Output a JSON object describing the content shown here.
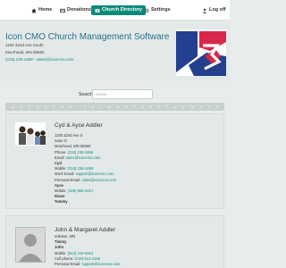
{
  "nav": {
    "home": "Home",
    "donations": "Donations",
    "church_directory": "Church Directory",
    "settings": "Settings",
    "logoff": "Log off"
  },
  "church": {
    "name": "Icon CMO Church Management Software",
    "address1": "1100 32nd Ave South",
    "address2": "Moorhead, MN 56560",
    "phone": "(218) 236-1699",
    "separator": " - ",
    "email": "sales@iconcmo.com"
  },
  "search": {
    "label": "Search:",
    "placeholder": "Name"
  },
  "alphabet": [
    "A",
    "B",
    "C",
    "D",
    "E",
    "F",
    "G",
    "H",
    "I",
    "J",
    "K",
    "L",
    "M",
    "N",
    "O",
    "P",
    "Q",
    "R",
    "S",
    "T",
    "U",
    "V",
    "W",
    "X",
    "Y",
    "Z"
  ],
  "families": [
    {
      "name": "Cyd & Ayce Addler",
      "lines": [
        {
          "text": "1100 32nd Ave S",
          "style": "plain"
        },
        {
          "text": "Suite G",
          "style": "plain"
        },
        {
          "text": "Moorhead, MN 56560",
          "style": "plain"
        },
        {
          "prefix": "Phone: ",
          "text": "(218) 236-1699",
          "style": "link"
        },
        {
          "prefix": "Email: ",
          "text": "sales@iconcmo.com",
          "style": "link"
        },
        {
          "text": "Cyd",
          "style": "bold"
        },
        {
          "prefix": "Mobile: ",
          "text": "(218) 236-1699",
          "style": "link"
        },
        {
          "prefix": "Work Email: ",
          "text": "support@iconcmo.com",
          "style": "link"
        },
        {
          "prefix": "Personal Email: ",
          "text": "sales@iconcmo.com",
          "style": "link"
        },
        {
          "text": "Ayce",
          "style": "bold"
        },
        {
          "prefix": "Mobile: ",
          "text": "(328) 980-4417",
          "style": "link"
        },
        {
          "text": "Riane",
          "style": "bold"
        },
        {
          "text": "Tommy",
          "style": "bold"
        }
      ]
    },
    {
      "name": "John & Margaret Addler",
      "lines": [
        {
          "text": "unkown, MN",
          "style": "plain"
        },
        {
          "text": "Timmy",
          "style": "bold"
        },
        {
          "text": "John",
          "style": "bold"
        },
        {
          "prefix": "Mobile: ",
          "text": "(812) 210-6912",
          "style": "link"
        },
        {
          "prefix": "Cell phone: ",
          "text": "(218) 512-2198",
          "style": "link"
        },
        {
          "prefix": "Personal Email: ",
          "text": "support@iconcmo.com",
          "style": "link"
        }
      ]
    }
  ],
  "colors": {
    "accent": "#0e8a7a",
    "title": "#2b6e86",
    "panel": "#e3e9e9",
    "alphabet_bar": "#c9d0d0"
  }
}
